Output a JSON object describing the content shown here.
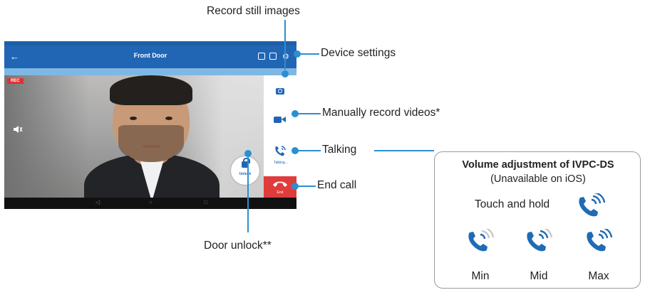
{
  "callouts": {
    "record_still": "Record still images",
    "device_settings": "Device settings",
    "manual_record": "Manually record videos*",
    "talking": "Talking",
    "end_call": "End call",
    "door_unlock": "Door unlock**"
  },
  "app": {
    "title": "Front Door",
    "rec_badge": "REC",
    "unlock_label": "Unlock",
    "talking_label": "Talking...",
    "end_label": "End"
  },
  "volume": {
    "title": "Volume adjustment of IVPC-DS",
    "subtitle": "(Unavailable on iOS)",
    "hold_text": "Touch and hold",
    "levels": [
      "Min",
      "Mid",
      "Max"
    ]
  },
  "colors": {
    "accent": "#2b8fd2",
    "app_blue": "#2166b4",
    "end_red": "#e03c3c"
  },
  "icons": [
    "back-arrow-icon",
    "camera-icon",
    "video-camera-icon",
    "phone-talking-icon",
    "end-call-icon",
    "unlock-icon",
    "speaker-icon"
  ]
}
